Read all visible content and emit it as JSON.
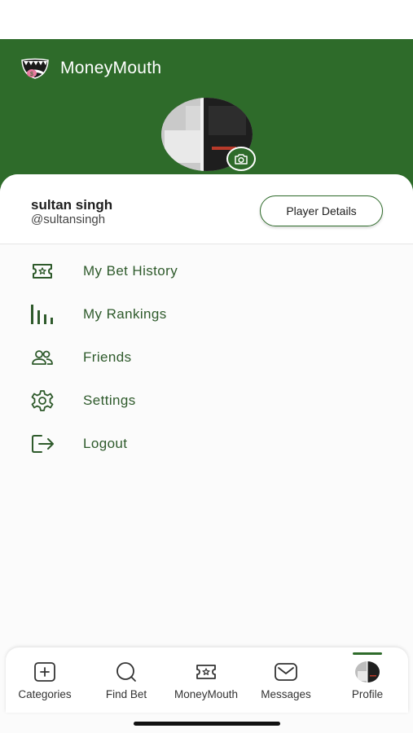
{
  "app": {
    "name": "MoneyMouth",
    "brand_color": "#2e6b2a",
    "accent_text": "#2e5a2b"
  },
  "profile": {
    "name": "sultan singh",
    "handle": "@sultansingh",
    "player_details_label": "Player Details"
  },
  "menu": {
    "items": [
      {
        "label": "My Bet History",
        "icon": "ticket-icon"
      },
      {
        "label": "My Rankings",
        "icon": "bar-chart-icon"
      },
      {
        "label": "Friends",
        "icon": "friends-icon"
      },
      {
        "label": "Settings",
        "icon": "gear-icon"
      },
      {
        "label": "Logout",
        "icon": "logout-icon"
      }
    ]
  },
  "tabbar": {
    "active": "Profile",
    "tabs": [
      {
        "label": "Categories",
        "icon": "plus-square-icon"
      },
      {
        "label": "Find Bet",
        "icon": "search-icon"
      },
      {
        "label": "MoneyMouth",
        "icon": "ticket-icon"
      },
      {
        "label": "Messages",
        "icon": "mail-icon"
      },
      {
        "label": "Profile",
        "icon": "avatar-icon"
      }
    ]
  }
}
